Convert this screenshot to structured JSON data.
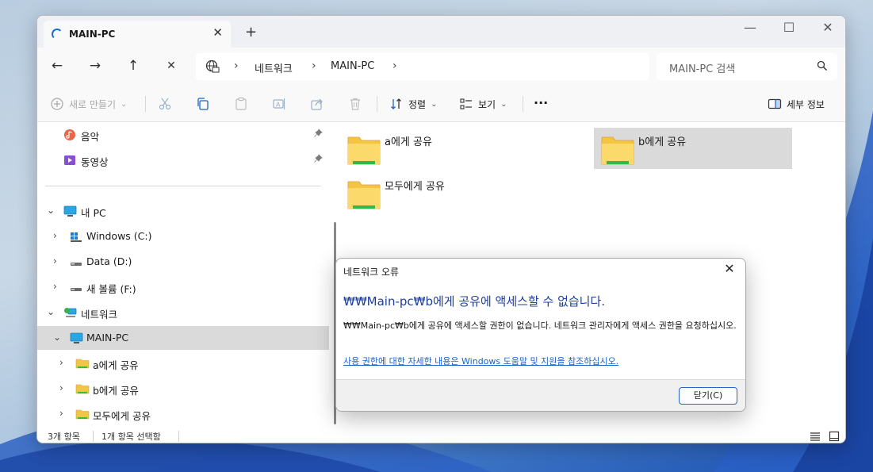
{
  "window": {
    "tab_title": "MAIN-PC",
    "new_tab": "+",
    "controls": {
      "minimize": "—",
      "maximize": "☐",
      "close": "✕"
    }
  },
  "nav": {
    "back": "←",
    "forward": "→",
    "up": "↑",
    "stop": "✕"
  },
  "breadcrumb": {
    "items": [
      "네트워크",
      "MAIN-PC"
    ]
  },
  "search": {
    "placeholder": "MAIN-PC 검색"
  },
  "toolbar": {
    "new_label": "새로 만들기",
    "sort_label": "정렬",
    "view_label": "보기",
    "more_label": "···",
    "details_label": "세부 정보"
  },
  "sidebar": {
    "items": [
      {
        "label": "음악",
        "icon": "music-icon",
        "pinned": true
      },
      {
        "label": "동영상",
        "icon": "video-icon",
        "pinned": true
      },
      {
        "label": "내 PC",
        "icon": "monitor-icon",
        "expanded": true
      },
      {
        "label": "Windows (C:)",
        "icon": "windows-drive-icon"
      },
      {
        "label": "Data (D:)",
        "icon": "drive-icon"
      },
      {
        "label": "새 볼륨 (F:)",
        "icon": "drive-icon"
      },
      {
        "label": "네트워크",
        "icon": "network-icon",
        "expanded": true
      },
      {
        "label": "MAIN-PC",
        "icon": "monitor-icon",
        "expanded": true,
        "selected": true
      },
      {
        "label": "a에게 공유",
        "icon": "folder-icon"
      },
      {
        "label": "b에게 공유",
        "icon": "folder-icon"
      },
      {
        "label": "모두에게 공유",
        "icon": "folder-icon"
      }
    ]
  },
  "content": {
    "folders": [
      {
        "label": "a에게 공유",
        "selected": false
      },
      {
        "label": "b에게 공유",
        "selected": true
      },
      {
        "label": "모두에게 공유",
        "selected": false
      }
    ]
  },
  "status": {
    "item_count": "3개 항목",
    "selected_count": "1개 항목 선택함"
  },
  "dialog": {
    "title": "네트워크 오류",
    "heading": "₩₩Main-pc₩b에게 공유에 액세스할 수 없습니다.",
    "body": "₩₩Main-pc₩b에게 공유에 액세스할 권한이 없습니다. 네트워크 관리자에게 액세스 권한을 요청하십시오.",
    "link": "사용 권한에 대한 자세한 내용은 Windows 도움말 및 지원을 참조하십시오.",
    "button": "닫기(C)"
  },
  "colors": {
    "accent": "#1a62c8",
    "heading_blue": "#1c3fa0",
    "selection": "#dadada",
    "folder_yellow": "#f6c445"
  }
}
